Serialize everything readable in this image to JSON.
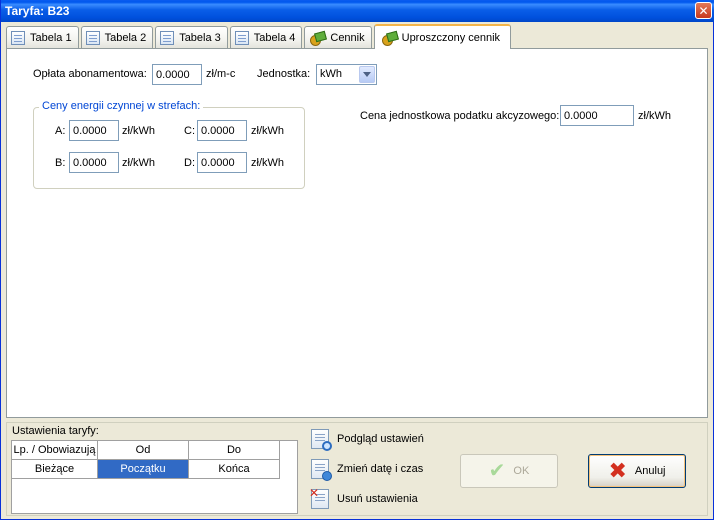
{
  "window": {
    "title": "Taryfa: B23"
  },
  "tabs": [
    {
      "label": "Tabela 1",
      "icon": "document-icon"
    },
    {
      "label": "Tabela 2",
      "icon": "document-icon"
    },
    {
      "label": "Tabela 3",
      "icon": "document-icon"
    },
    {
      "label": "Tabela 4",
      "icon": "document-icon"
    },
    {
      "label": "Cennik",
      "icon": "coins-icon"
    },
    {
      "label": "Uproszczony cennik",
      "icon": "coins-icon",
      "active": true
    }
  ],
  "form": {
    "subscription_label": "Opłata abonamentowa:",
    "subscription_value": "0.0000",
    "subscription_unit": "zł/m-c",
    "unit_label": "Jednostka:",
    "unit_value": "kWh",
    "zones_title": "Ceny energii czynnej w strefach:",
    "zones": {
      "a_label": "A:",
      "a_value": "0.0000",
      "a_unit": "zł/kWh",
      "b_label": "B:",
      "b_value": "0.0000",
      "b_unit": "zł/kWh",
      "c_label": "C:",
      "c_value": "0.0000",
      "c_unit": "zł/kWh",
      "d_label": "D:",
      "d_value": "0.0000",
      "d_unit": "zł/kWh"
    },
    "excise_label": "Cena jednostkowa podatku akcyzowego:",
    "excise_value": "0.0000",
    "excise_unit": "zł/kWh"
  },
  "settings": {
    "title": "Ustawienia taryfy:",
    "headers": [
      "Lp. / Obowiazują",
      "Od",
      "Do"
    ],
    "row": [
      "Bieżące",
      "Początku",
      "Końca"
    ]
  },
  "actions": {
    "preview": "Podgląd ustawień",
    "change_date": "Zmień datę i czas",
    "delete": "Usuń ustawienia"
  },
  "buttons": {
    "ok": "OK",
    "cancel": "Anuluj"
  }
}
